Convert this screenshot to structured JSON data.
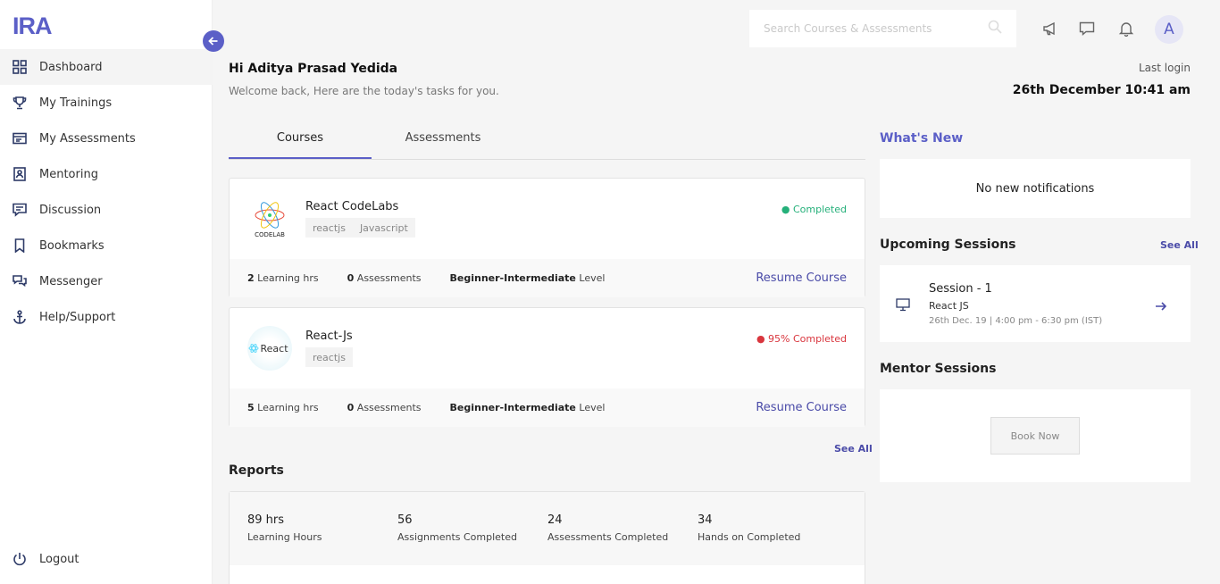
{
  "app": {
    "logo": "IRA"
  },
  "sidebar": {
    "items": [
      {
        "label": "Dashboard",
        "icon": "grid-icon"
      },
      {
        "label": "My Trainings",
        "icon": "trophy-icon"
      },
      {
        "label": "My Assessments",
        "icon": "card-icon"
      },
      {
        "label": "Mentoring",
        "icon": "person-badge-icon"
      },
      {
        "label": "Discussion",
        "icon": "chat-icon"
      },
      {
        "label": "Bookmarks",
        "icon": "bookmark-icon"
      },
      {
        "label": "Messenger",
        "icon": "messages-icon"
      },
      {
        "label": "Help/Support",
        "icon": "anchor-icon"
      }
    ],
    "logout": "Logout"
  },
  "header": {
    "search_placeholder": "Search Courses & Assessments",
    "avatar_initial": "A"
  },
  "greeting": {
    "title": "Hi Aditya Prasad Yedida",
    "subtitle": "Welcome back, Here are the today's tasks for you.",
    "last_login_label": "Last login",
    "last_login_value": "26th December 10:41 am"
  },
  "tabs": [
    "Courses",
    "Assessments"
  ],
  "courses": [
    {
      "title": "React CodeLabs",
      "tags": [
        "reactjs",
        "Javascript"
      ],
      "logo_text": "CODELAB",
      "status": "Completed",
      "hours": "2",
      "hours_label": "Learning hrs",
      "assessments": "0",
      "assessments_label": "Assessments",
      "level": "Beginner-Intermediate",
      "level_label": "Level",
      "action": "Resume Course"
    },
    {
      "title": "React-Js",
      "tags": [
        "reactjs"
      ],
      "logo_text": "React",
      "status": "95% Completed",
      "hours": "5",
      "hours_label": "Learning hrs",
      "assessments": "0",
      "assessments_label": "Assessments",
      "level": "Beginner-Intermediate",
      "level_label": "Level",
      "action": "Resume Course"
    }
  ],
  "courses_see_all": "See All",
  "reports": {
    "title": "Reports",
    "stats": [
      {
        "value": "89 hrs",
        "label": "Learning Hours"
      },
      {
        "value": "56",
        "label": "Assignments Completed"
      },
      {
        "value": "24",
        "label": "Assessments Completed"
      },
      {
        "value": "34",
        "label": "Hands on Completed"
      }
    ]
  },
  "whats_new": {
    "title": "What's New",
    "empty": "No new notifications"
  },
  "upcoming": {
    "title": "Upcoming Sessions",
    "see_all": "See All",
    "session": {
      "name": "Session - 1",
      "course": "React JS",
      "time": "26th Dec. 19 | 4:00 pm - 6:30 pm (IST)"
    }
  },
  "mentor": {
    "title": "Mentor Sessions",
    "button": "Book Now"
  },
  "colors": {
    "accent": "#5b5fc7",
    "success": "#25b07a",
    "danger": "#d9363e"
  }
}
